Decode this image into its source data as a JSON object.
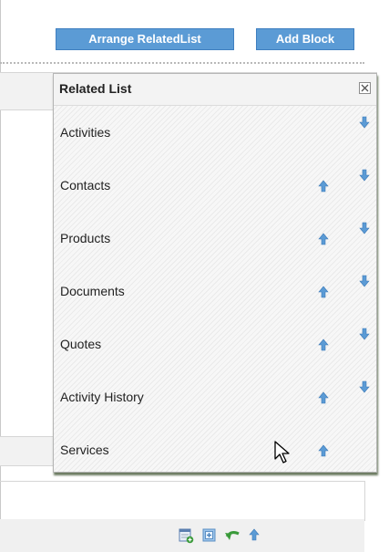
{
  "toolbar": {
    "arrange_label": "Arrange RelatedList",
    "add_block_label": "Add Block"
  },
  "related_list": {
    "title": "Related List",
    "items": [
      {
        "label": "Activities",
        "up": false,
        "down": true
      },
      {
        "label": "Contacts",
        "up": true,
        "down": true
      },
      {
        "label": "Products",
        "up": true,
        "down": true
      },
      {
        "label": "Documents",
        "up": true,
        "down": true
      },
      {
        "label": "Quotes",
        "up": true,
        "down": true
      },
      {
        "label": "Activity History",
        "up": true,
        "down": true
      },
      {
        "label": "Services",
        "up": true,
        "down": false
      }
    ]
  },
  "footer_icons": [
    "add-field-icon",
    "add-block-icon",
    "undo-icon",
    "move-up-icon"
  ],
  "colors": {
    "button_bg": "#5b9bd5",
    "arrow_blue": "#5b9bd5",
    "undo_green": "#3a9a3a"
  }
}
